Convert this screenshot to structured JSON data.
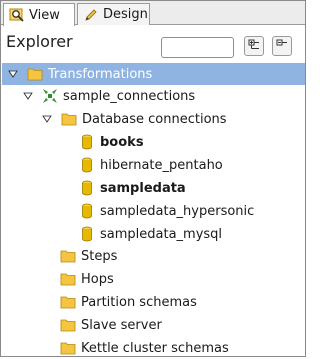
{
  "tabs": [
    {
      "label": "View",
      "active": true
    },
    {
      "label": "Design",
      "active": false
    }
  ],
  "explorer": {
    "title": "Explorer",
    "search_value": ""
  },
  "tree": {
    "root": {
      "label": "Transformations",
      "expanded": true,
      "selected": true
    },
    "transformation": {
      "label": "sample_connections",
      "expanded": true
    },
    "db_folder": {
      "label": "Database connections",
      "expanded": true
    },
    "connections": [
      {
        "label": "books",
        "bold": true
      },
      {
        "label": "hibernate_pentaho",
        "bold": false
      },
      {
        "label": "sampledata",
        "bold": true
      },
      {
        "label": "sampledata_hypersonic",
        "bold": false
      },
      {
        "label": "sampledata_mysql",
        "bold": false
      }
    ],
    "folders": [
      {
        "label": "Steps"
      },
      {
        "label": "Hops"
      },
      {
        "label": "Partition schemas"
      },
      {
        "label": "Slave server"
      },
      {
        "label": "Kettle cluster schemas"
      }
    ]
  },
  "colors": {
    "selection": "#8fb4e1",
    "folder": "#f5c542",
    "db": "#e6b800",
    "transform": "#2f8f2f"
  }
}
